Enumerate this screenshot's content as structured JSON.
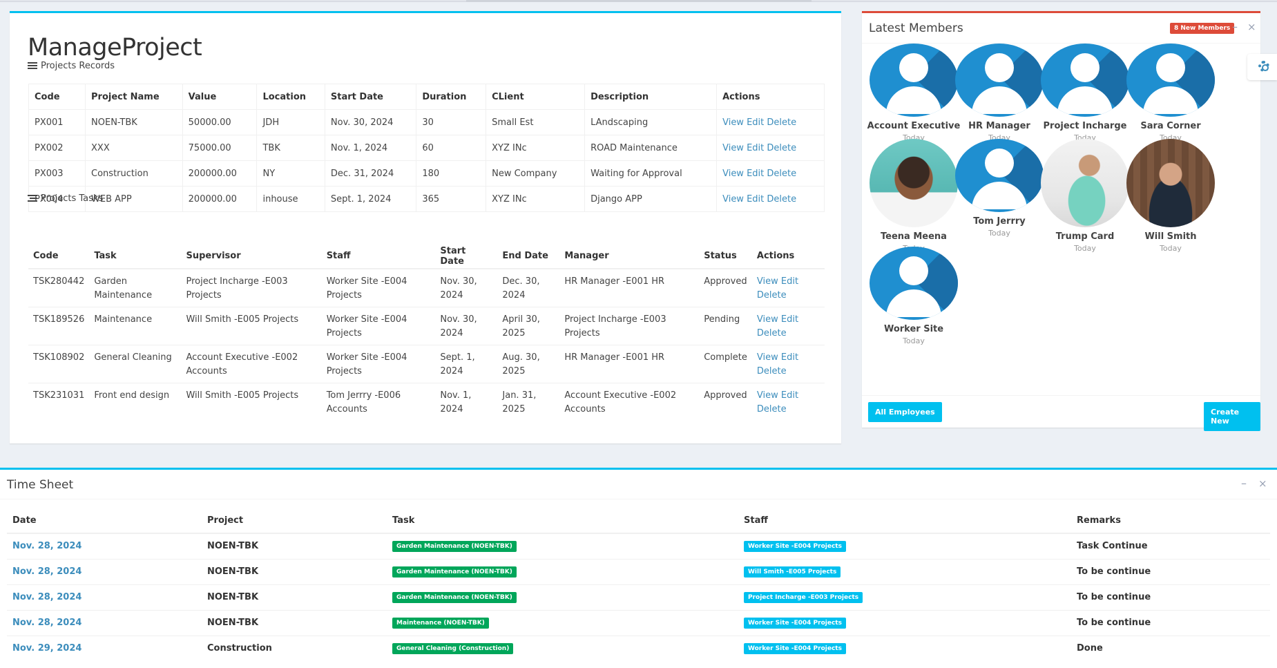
{
  "manage_project": {
    "title": "ManageProject",
    "records_label": "Projects Records",
    "records_columns": [
      "Code",
      "Project Name",
      "Value",
      "Location",
      "Start Date",
      "Duration",
      "CLient",
      "Description",
      "Actions"
    ],
    "records": [
      {
        "code": "PX001",
        "name": "NOEN-TBK",
        "value": "50000.00",
        "location": "JDH",
        "start": "Nov. 30, 2024",
        "duration": "30",
        "client": "Small Est",
        "description": "LAndscaping"
      },
      {
        "code": "PX002",
        "name": "XXX",
        "value": "75000.00",
        "location": "TBK",
        "start": "Nov. 1, 2024",
        "duration": "60",
        "client": "XYZ INc",
        "description": "ROAD Maintenance"
      },
      {
        "code": "PX003",
        "name": "Construction",
        "value": "200000.00",
        "location": "NY",
        "start": "Dec. 31, 2024",
        "duration": "180",
        "client": "New Company",
        "description": "Waiting for Approval"
      },
      {
        "code": "PX004",
        "name": "WEB APP",
        "value": "200000.00",
        "location": "inhouse",
        "start": "Sept. 1, 2024",
        "duration": "365",
        "client": "XYZ INc",
        "description": "Django APP"
      }
    ],
    "action_labels": {
      "view": "View",
      "edit": "Edit",
      "delete": "Delete"
    },
    "tasks_label": "Projects Tasks",
    "tasks_columns": [
      "Code",
      "Task",
      "Supervisor",
      "Staff",
      "Start Date",
      "End Date",
      "Manager",
      "Status",
      "Actions"
    ],
    "tasks": [
      {
        "code": "TSK280442",
        "task": "Garden Maintenance",
        "supervisor": "Project Incharge -E003 Projects",
        "staff": "Worker Site -E004 Projects",
        "start": "Nov. 30, 2024",
        "end": "Dec. 30, 2024",
        "manager": "HR Manager -E001 HR",
        "status": "Approved"
      },
      {
        "code": "TSK189526",
        "task": "Maintenance",
        "supervisor": "Will Smith -E005 Projects",
        "staff": "Worker Site -E004 Projects",
        "start": "Nov. 30, 2024",
        "end": "April 30, 2025",
        "manager": "Project Incharge -E003 Projects",
        "status": "Pending"
      },
      {
        "code": "TSK108902",
        "task": "General Cleaning",
        "supervisor": "Account Executive -E002 Accounts",
        "staff": "Worker Site -E004 Projects",
        "start": "Sept. 1, 2024",
        "end": "Aug. 30, 2025",
        "manager": "HR Manager -E001 HR",
        "status": "Complete"
      },
      {
        "code": "TSK231031",
        "task": "Front end design",
        "supervisor": "Will Smith -E005 Projects",
        "staff": "Tom Jerrry -E006 Accounts",
        "start": "Nov. 1, 2024",
        "end": "Jan. 31, 2025",
        "manager": "Account Executive -E002 Accounts",
        "status": "Approved"
      }
    ]
  },
  "members": {
    "title": "Latest Members",
    "badge": "8 New Members",
    "list": [
      {
        "name": "Account Executive",
        "date": "Today",
        "avatar": "generic"
      },
      {
        "name": "HR Manager",
        "date": "Today",
        "avatar": "generic"
      },
      {
        "name": "Project Incharge",
        "date": "Today",
        "avatar": "generic"
      },
      {
        "name": "Sara Corner",
        "date": "Today",
        "avatar": "generic"
      },
      {
        "name": "Teena Meena",
        "date": "Today",
        "avatar": "photo"
      },
      {
        "name": "Tom Jerrry",
        "date": "Today",
        "avatar": "generic"
      },
      {
        "name": "Trump Card",
        "date": "Today",
        "avatar": "photo"
      },
      {
        "name": "Will Smith",
        "date": "Today",
        "avatar": "photo"
      },
      {
        "name": "Worker Site",
        "date": "Today",
        "avatar": "generic"
      }
    ],
    "all_button": "All Employees",
    "create_button": "Create New"
  },
  "timesheet": {
    "title": "Time Sheet",
    "columns": [
      "Date",
      "Project",
      "Task",
      "Staff",
      "Remarks"
    ],
    "rows": [
      {
        "date": "Nov. 28, 2024",
        "project": "NOEN-TBK",
        "task": "Garden Maintenance (NOEN-TBK)",
        "staff": "Worker Site -E004 Projects",
        "remarks": "Task Continue"
      },
      {
        "date": "Nov. 28, 2024",
        "project": "NOEN-TBK",
        "task": "Garden Maintenance (NOEN-TBK)",
        "staff": "Will Smith -E005 Projects",
        "remarks": "To be continue"
      },
      {
        "date": "Nov. 28, 2024",
        "project": "NOEN-TBK",
        "task": "Garden Maintenance (NOEN-TBK)",
        "staff": "Project Incharge -E003 Projects",
        "remarks": "To be continue"
      },
      {
        "date": "Nov. 28, 2024",
        "project": "NOEN-TBK",
        "task": "Maintenance (NOEN-TBK)",
        "staff": "Worker Site -E004 Projects",
        "remarks": "To be continue"
      },
      {
        "date": "Nov. 29, 2024",
        "project": "Construction",
        "task": "General Cleaning (Construction)",
        "staff": "Worker Site -E004 Projects",
        "remarks": "Done"
      }
    ]
  },
  "colors": {
    "accent": "#00c0ef",
    "danger": "#dd4b39",
    "link": "#3c8dbc",
    "success": "#00a65a"
  },
  "icons": {
    "minimize": "minus-icon",
    "close": "close-icon",
    "settings": "gear-icon",
    "records": "list-icon",
    "tasks": "tasks-icon"
  }
}
